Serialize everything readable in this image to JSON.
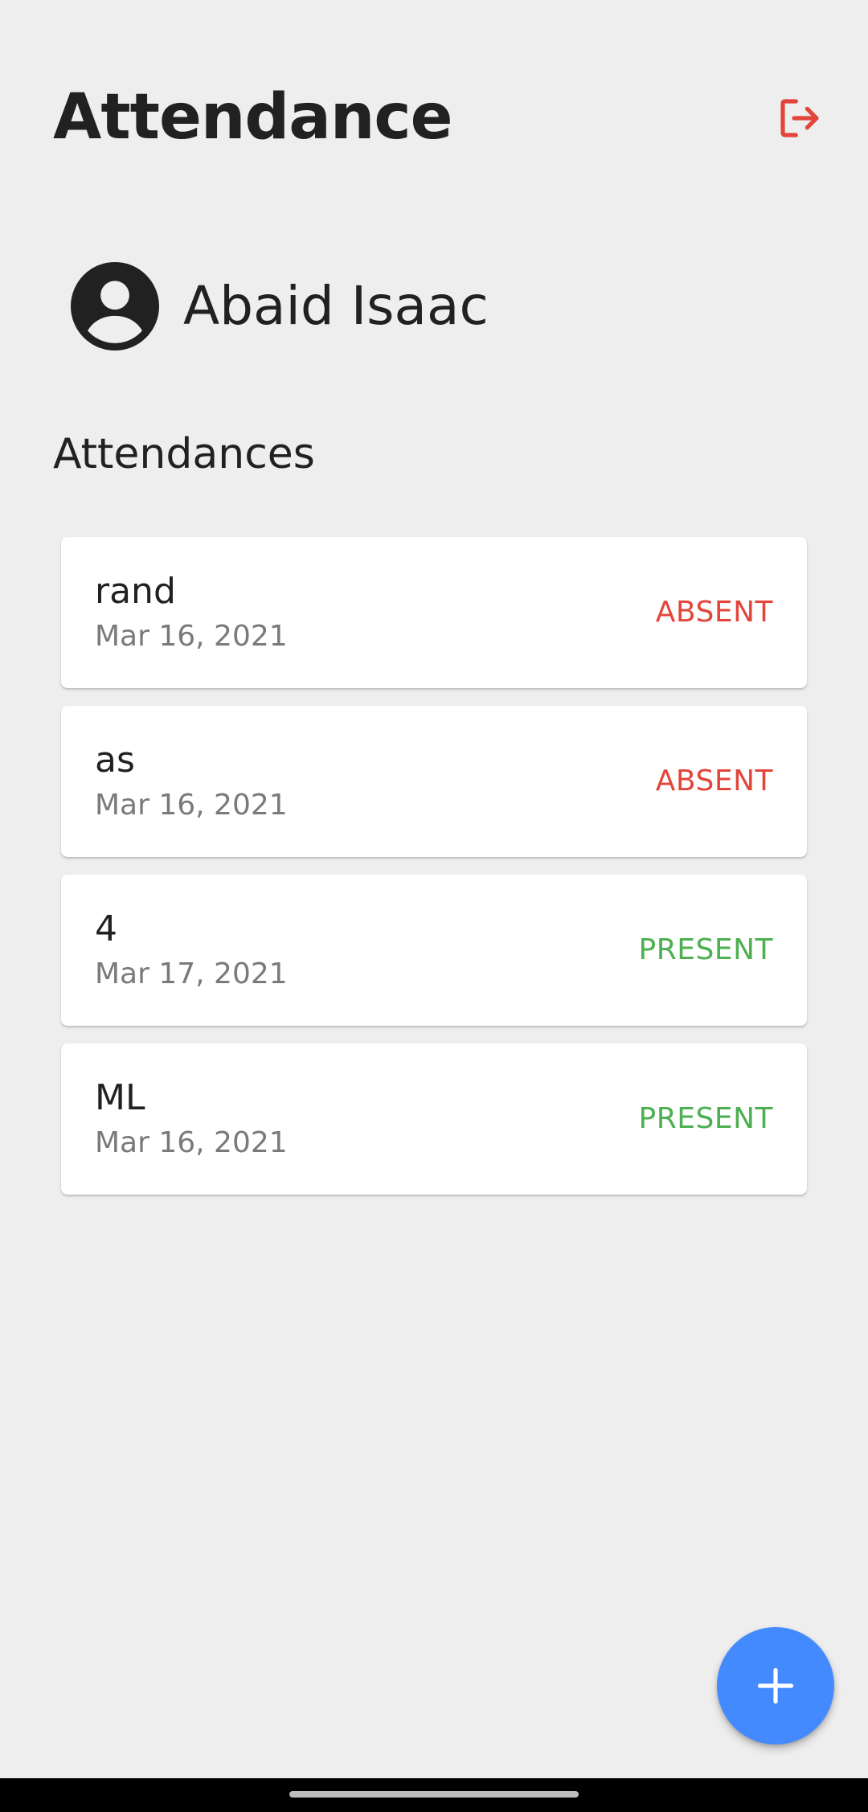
{
  "header": {
    "title": "Attendance",
    "logout_icon": "logout-icon",
    "logout_color": "#e3453a"
  },
  "profile": {
    "avatar_icon": "account-circle-icon",
    "name": "Abaid Isaac"
  },
  "section": {
    "title": "Attendances"
  },
  "attendances": [
    {
      "title": "rand",
      "date": "Mar 16, 2021",
      "status": "ABSENT"
    },
    {
      "title": "as",
      "date": "Mar 16, 2021",
      "status": "ABSENT"
    },
    {
      "title": "4",
      "date": "Mar 17, 2021",
      "status": "PRESENT"
    },
    {
      "title": "ML",
      "date": "Mar 16, 2021",
      "status": "PRESENT"
    }
  ],
  "colors": {
    "absent": "#e3453a",
    "present": "#4caf50",
    "fab": "#448aff",
    "background": "#eeeeee"
  },
  "fab": {
    "icon": "plus-icon"
  }
}
